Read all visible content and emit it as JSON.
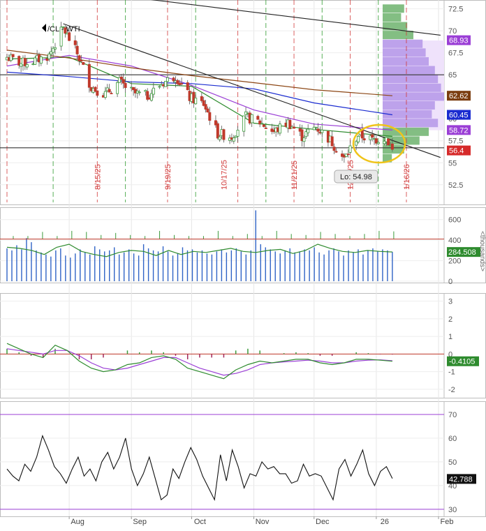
{
  "chart_data": {
    "type": "candlestick",
    "symbol_label": "/CL - WTI",
    "x_tick_labels": [
      "Aug",
      "Sep",
      "Oct",
      "Nov",
      "Dec",
      "26",
      "Feb"
    ],
    "price_panel": {
      "y_ticks": [
        72.5,
        70,
        67.5,
        65,
        62.5,
        60,
        57.5,
        55,
        52.5
      ],
      "ylim": [
        50.5,
        73.5
      ],
      "vertical_date_labels": [
        "8/15/25",
        "9/19/25",
        "10/17/25",
        "11/21/25",
        "12/19/25",
        "1/16/26"
      ],
      "value_badges": [
        {
          "value": "68.93",
          "color": "#9b3fd6"
        },
        {
          "value": "62.62",
          "color": "#7b3d10"
        },
        {
          "value": "60.45",
          "color": "#1a2bd0"
        },
        {
          "value": "58.72",
          "color": "#9b3fd6"
        },
        {
          "value": "56.4",
          "color": "#d62a2a"
        }
      ],
      "low_annotation": "Lo: 54.98",
      "horizontal_lines": [
        65.0,
        56.7
      ],
      "trendlines": [
        {
          "from": [
            "2025-07-10",
            75.3
          ],
          "to": [
            "2026-02-02",
            69.5
          ]
        },
        {
          "from": [
            "2025-07-29",
            70.8
          ],
          "to": [
            "2026-02-02",
            55.6
          ]
        }
      ],
      "close_series": [
        {
          "date": "2025-07-01",
          "close": 67.0
        },
        {
          "date": "2025-07-08",
          "close": 66.3
        },
        {
          "date": "2025-07-15",
          "close": 66.6
        },
        {
          "date": "2025-07-22",
          "close": 67.2
        },
        {
          "date": "2025-07-29",
          "close": 70.3
        },
        {
          "date": "2025-08-05",
          "close": 67.4
        },
        {
          "date": "2025-08-12",
          "close": 63.6
        },
        {
          "date": "2025-08-19",
          "close": 62.8
        },
        {
          "date": "2025-08-26",
          "close": 64.2
        },
        {
          "date": "2025-09-02",
          "close": 62.9
        },
        {
          "date": "2025-09-09",
          "close": 62.6
        },
        {
          "date": "2025-09-16",
          "close": 64.0
        },
        {
          "date": "2025-09-23",
          "close": 64.9
        },
        {
          "date": "2025-09-30",
          "close": 62.4
        },
        {
          "date": "2025-10-07",
          "close": 61.7
        },
        {
          "date": "2025-10-14",
          "close": 58.3
        },
        {
          "date": "2025-10-21",
          "close": 58.0
        },
        {
          "date": "2025-10-28",
          "close": 60.2
        },
        {
          "date": "2025-11-04",
          "close": 59.6
        },
        {
          "date": "2025-11-11",
          "close": 58.5
        },
        {
          "date": "2025-11-18",
          "close": 59.6
        },
        {
          "date": "2025-11-25",
          "close": 58.0
        },
        {
          "date": "2025-12-02",
          "close": 59.1
        },
        {
          "date": "2025-12-09",
          "close": 57.6
        },
        {
          "date": "2025-12-16",
          "close": 55.4
        },
        {
          "date": "2025-12-23",
          "close": 58.2
        },
        {
          "date": "2025-12-30",
          "close": 57.6
        },
        {
          "date": "2026-01-06",
          "close": 57.9
        },
        {
          "date": "2026-01-09",
          "close": 56.4
        }
      ],
      "moving_averages": [
        {
          "color": "#2e8b2e",
          "points": [
            [
              "2025-07-01",
              66.8
            ],
            [
              "2025-08-01",
              67.0
            ],
            [
              "2025-09-01",
              64.0
            ],
            [
              "2025-10-01",
              63.7
            ],
            [
              "2025-11-01",
              59.5
            ],
            [
              "2025-12-01",
              58.8
            ],
            [
              "2026-01-09",
              58.0
            ]
          ]
        },
        {
          "color": "#9b3fd6",
          "points": [
            [
              "2025-07-01",
              66.0
            ],
            [
              "2025-08-01",
              67.2
            ],
            [
              "2025-09-01",
              66.0
            ],
            [
              "2025-10-01",
              63.8
            ],
            [
              "2025-11-01",
              61.0
            ],
            [
              "2025-12-01",
              59.4
            ],
            [
              "2026-01-09",
              58.72
            ]
          ]
        },
        {
          "color": "#1a2bd0",
          "points": [
            [
              "2025-07-01",
              65.3
            ],
            [
              "2025-08-01",
              64.8
            ],
            [
              "2025-09-01",
              64.2
            ],
            [
              "2025-10-01",
              64.0
            ],
            [
              "2025-11-01",
              63.4
            ],
            [
              "2025-12-01",
              61.8
            ],
            [
              "2026-01-09",
              60.45
            ]
          ]
        },
        {
          "color": "#8b4513",
          "points": [
            [
              "2025-07-01",
              67.8
            ],
            [
              "2025-08-01",
              66.9
            ],
            [
              "2025-09-01",
              65.8
            ],
            [
              "2025-10-01",
              64.9
            ],
            [
              "2025-11-01",
              64.1
            ],
            [
              "2025-12-01",
              63.3
            ],
            [
              "2026-01-09",
              62.62
            ]
          ]
        }
      ],
      "volume_profile": {
        "bins": [
          {
            "price": 72.5,
            "weight": 0.35
          },
          {
            "price": 71.5,
            "weight": 0.3
          },
          {
            "price": 70.5,
            "weight": 0.4
          },
          {
            "price": 69.5,
            "weight": 0.5
          },
          {
            "price": 68.5,
            "weight": 0.65
          },
          {
            "price": 67.5,
            "weight": 0.7
          },
          {
            "price": 66.5,
            "weight": 0.75
          },
          {
            "price": 65.5,
            "weight": 0.85
          },
          {
            "price": 64.5,
            "weight": 0.9
          },
          {
            "price": 63.5,
            "weight": 0.95
          },
          {
            "price": 62.5,
            "weight": 1.0
          },
          {
            "price": 61.5,
            "weight": 0.85
          },
          {
            "price": 60.5,
            "weight": 0.8
          },
          {
            "price": 59.5,
            "weight": 0.9
          },
          {
            "price": 58.5,
            "weight": 0.75
          },
          {
            "price": 57.5,
            "weight": 0.6
          },
          {
            "price": 56.5,
            "weight": 0.35
          },
          {
            "price": 55.5,
            "weight": 0.15
          }
        ],
        "value_area": [
          58.7,
          68.9
        ]
      }
    },
    "volume_panel": {
      "unit_label": "<thousands>",
      "y_ticks": [
        600,
        400,
        200,
        0
      ],
      "ylim": [
        0,
        700
      ],
      "reference_line": 410,
      "last_value": "284.508",
      "bars": [
        320,
        300,
        350,
        310,
        420,
        380,
        300,
        280,
        260,
        240,
        300,
        320,
        250,
        230,
        270,
        310,
        280,
        260,
        340,
        310,
        290,
        300,
        330,
        260,
        280,
        310,
        270,
        250,
        360,
        320,
        300,
        290,
        340,
        290,
        250,
        270,
        330,
        300,
        310,
        280,
        300,
        270,
        260,
        290,
        310,
        280,
        300,
        320,
        290,
        260,
        300,
        690,
        360,
        330,
        310,
        290,
        270,
        300,
        320,
        280,
        290,
        310,
        300,
        330,
        280,
        260,
        300,
        320,
        290,
        250,
        300,
        280,
        310,
        260,
        300,
        320,
        290,
        310,
        300,
        285
      ],
      "average_line": [
        330,
        320,
        300,
        260,
        330,
        360,
        290,
        260,
        240,
        280,
        300,
        290,
        250,
        300,
        260,
        290,
        280,
        300,
        320,
        290,
        280,
        300,
        310,
        270,
        300,
        360,
        320,
        290,
        280,
        300,
        290,
        285
      ]
    },
    "macd_panel": {
      "y_ticks": [
        3,
        2,
        1,
        0,
        -1,
        -2
      ],
      "ylim": [
        -2.4,
        3.3
      ],
      "last_value": "-0.4105",
      "macd_line": [
        0.6,
        0.3,
        0.0,
        -0.2,
        0.5,
        0.2,
        -0.4,
        -0.8,
        -1.0,
        -0.9,
        -0.6,
        -0.5,
        -0.2,
        -0.1,
        -0.3,
        -0.8,
        -1.0,
        -1.2,
        -1.4,
        -0.9,
        -0.6,
        -0.4,
        -0.5,
        -0.4,
        -0.3,
        -0.3,
        -0.5,
        -0.6,
        -0.5,
        -0.3,
        -0.3,
        -0.35,
        -0.41
      ],
      "signal_line": [
        0.3,
        0.2,
        0.1,
        0.0,
        0.2,
        0.2,
        -0.1,
        -0.5,
        -0.8,
        -0.9,
        -0.8,
        -0.6,
        -0.4,
        -0.2,
        -0.2,
        -0.5,
        -0.8,
        -1.0,
        -1.2,
        -1.1,
        -0.9,
        -0.6,
        -0.5,
        -0.45,
        -0.4,
        -0.35,
        -0.4,
        -0.5,
        -0.5,
        -0.4,
        -0.35,
        -0.33,
        -0.38
      ]
    },
    "rsi_panel": {
      "y_ticks": [
        70,
        60,
        50,
        40,
        30
      ],
      "ylim": [
        27,
        75
      ],
      "overbought": 70,
      "oversold": 30,
      "last_value": "42.788",
      "rsi_line": [
        47,
        44,
        42,
        49,
        46,
        52,
        61,
        55,
        48,
        45,
        41,
        47,
        52,
        44,
        47,
        42,
        50,
        54,
        47,
        52,
        60,
        47,
        40,
        45,
        52,
        43,
        34,
        36,
        47,
        43,
        50,
        56,
        51,
        44,
        39,
        34,
        53,
        42,
        55,
        48,
        39,
        45,
        44,
        50,
        47,
        48,
        45,
        45,
        41,
        42,
        49,
        44,
        45,
        44,
        39,
        34,
        47,
        51,
        44,
        49,
        55,
        45,
        40,
        46,
        48,
        43
      ]
    }
  }
}
